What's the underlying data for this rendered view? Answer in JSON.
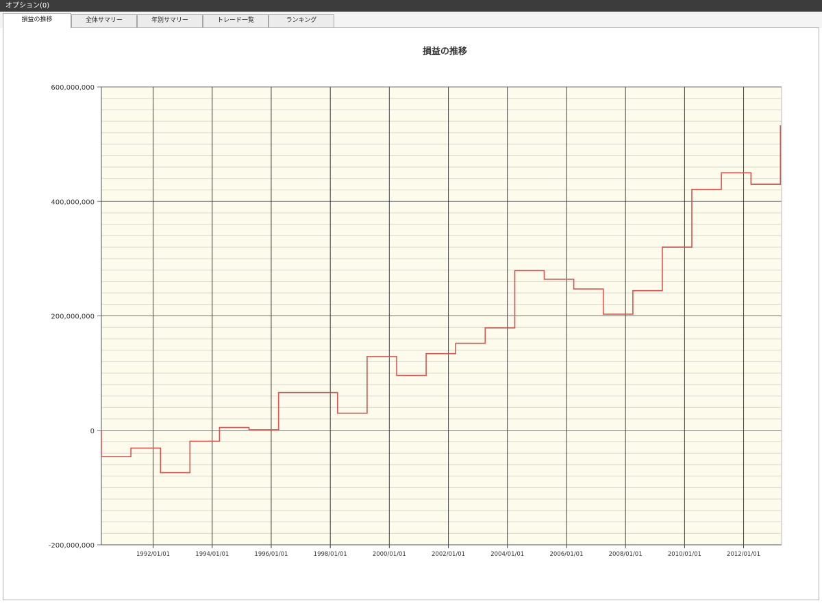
{
  "window": {
    "title": "オプション(0)"
  },
  "tabs": [
    {
      "label": "損益の推移",
      "active": true
    },
    {
      "label": "全体サマリー",
      "active": false
    },
    {
      "label": "年別サマリー",
      "active": false
    },
    {
      "label": "トレード一覧",
      "active": false
    },
    {
      "label": "ランキング",
      "active": false
    }
  ],
  "colors": {
    "plot_background": "#fcfbec",
    "line": "#d9534f",
    "titlebar": "#3c3c3c"
  },
  "chart_data": {
    "type": "line",
    "title": "損益の推移",
    "xlabel": "",
    "ylabel": "",
    "ylim": [
      -200000000,
      600000000
    ],
    "y_ticks": [
      -200000000,
      0,
      200000000,
      400000000,
      600000000
    ],
    "y_tick_labels": [
      "-200,000,000",
      "0",
      "200,000,000",
      "400,000,000",
      "600,000,000"
    ],
    "x_tick_labels": [
      "1992/01/01",
      "1994/01/01",
      "1996/01/01",
      "1998/01/01",
      "2000/01/01",
      "2002/01/01",
      "2004/01/01",
      "2006/01/01",
      "2008/01/01",
      "2010/01/01",
      "2012/01/01"
    ],
    "grid": true,
    "legend": "none",
    "series": [
      {
        "values": [
          {
            "x": "1990/04/01",
            "y": 0
          },
          {
            "x": "1990/04/01",
            "y": -46000000
          },
          {
            "x": "1991/04/01",
            "y": -46000000
          },
          {
            "x": "1991/04/01",
            "y": -31000000
          },
          {
            "x": "1992/04/01",
            "y": -31000000
          },
          {
            "x": "1992/04/01",
            "y": -74000000
          },
          {
            "x": "1993/04/01",
            "y": -74000000
          },
          {
            "x": "1993/04/01",
            "y": -19000000
          },
          {
            "x": "1994/04/01",
            "y": -19000000
          },
          {
            "x": "1994/04/01",
            "y": 5000000
          },
          {
            "x": "1995/04/01",
            "y": 5000000
          },
          {
            "x": "1995/04/01",
            "y": 1000000
          },
          {
            "x": "1996/04/01",
            "y": 1000000
          },
          {
            "x": "1996/04/01",
            "y": 66000000
          },
          {
            "x": "1998/04/01",
            "y": 66000000
          },
          {
            "x": "1998/04/01",
            "y": 30000000
          },
          {
            "x": "1999/04/01",
            "y": 30000000
          },
          {
            "x": "1999/04/01",
            "y": 129000000
          },
          {
            "x": "2000/04/01",
            "y": 129000000
          },
          {
            "x": "2000/04/01",
            "y": 96000000
          },
          {
            "x": "2001/04/01",
            "y": 96000000
          },
          {
            "x": "2001/04/01",
            "y": 134000000
          },
          {
            "x": "2002/04/01",
            "y": 134000000
          },
          {
            "x": "2002/04/01",
            "y": 152000000
          },
          {
            "x": "2003/04/01",
            "y": 152000000
          },
          {
            "x": "2003/04/01",
            "y": 179000000
          },
          {
            "x": "2004/04/01",
            "y": 179000000
          },
          {
            "x": "2004/04/01",
            "y": 279000000
          },
          {
            "x": "2005/04/01",
            "y": 279000000
          },
          {
            "x": "2005/04/01",
            "y": 264000000
          },
          {
            "x": "2006/04/01",
            "y": 264000000
          },
          {
            "x": "2006/04/01",
            "y": 247000000
          },
          {
            "x": "2007/04/01",
            "y": 247000000
          },
          {
            "x": "2007/04/01",
            "y": 203000000
          },
          {
            "x": "2008/04/01",
            "y": 203000000
          },
          {
            "x": "2008/04/01",
            "y": 244000000
          },
          {
            "x": "2009/04/01",
            "y": 244000000
          },
          {
            "x": "2009/04/01",
            "y": 320000000
          },
          {
            "x": "2010/04/01",
            "y": 320000000
          },
          {
            "x": "2010/04/01",
            "y": 421000000
          },
          {
            "x": "2011/04/01",
            "y": 421000000
          },
          {
            "x": "2011/04/01",
            "y": 450000000
          },
          {
            "x": "2012/04/01",
            "y": 450000000
          },
          {
            "x": "2012/04/01",
            "y": 430000000
          },
          {
            "x": "2013/04/01",
            "y": 430000000
          },
          {
            "x": "2013/04/01",
            "y": 533000000
          }
        ]
      }
    ]
  }
}
